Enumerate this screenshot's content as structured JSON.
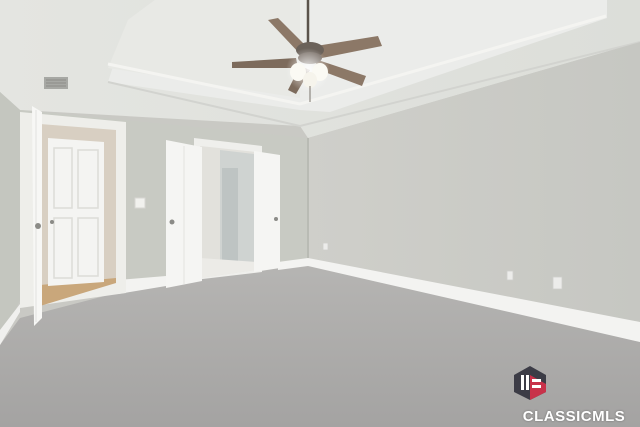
{
  "photo": {
    "subject": "empty-bedroom-interior"
  },
  "watermark": {
    "brand_text": "CLASSICMLS",
    "logo_icon": "classic-mls-logo-icon",
    "colors": {
      "dark": "#3c3c46",
      "accent": "#c8324a"
    }
  }
}
